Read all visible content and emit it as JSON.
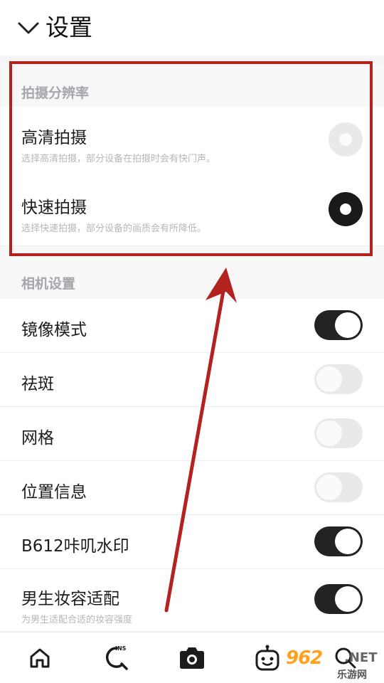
{
  "header": {
    "title": "设置"
  },
  "resolution": {
    "section_title": "拍摄分辨率",
    "options": [
      {
        "label": "高清拍摄",
        "desc": "选择高清拍摄，部分设备在拍摄时会有快门声。",
        "selected": false
      },
      {
        "label": "快速拍摄",
        "desc": "选择快速拍摄，部分设备的画质会有所降低。",
        "selected": true
      }
    ]
  },
  "camera": {
    "section_title": "相机设置",
    "items": [
      {
        "label": "镜像模式",
        "on": true
      },
      {
        "label": "祛斑",
        "on": false
      },
      {
        "label": "网格",
        "on": false
      },
      {
        "label": "位置信息",
        "on": false
      },
      {
        "label": "B612咔叽水印",
        "on": true
      },
      {
        "label": "男生妆容适配",
        "desc": "为男生适配合适的妆容强度",
        "on": true
      }
    ]
  },
  "bottom_nav": {
    "items": [
      {
        "icon": "home-icon"
      },
      {
        "icon": "ins-search-icon",
        "badge": "INS"
      },
      {
        "icon": "camera-icon"
      },
      {
        "icon": "robot-face-icon"
      },
      {
        "icon": "search-icon"
      }
    ]
  },
  "annotation_color": "#b3221f",
  "watermark": {
    "number": "962",
    "suffix": ".NET",
    "site": "乐游网"
  }
}
